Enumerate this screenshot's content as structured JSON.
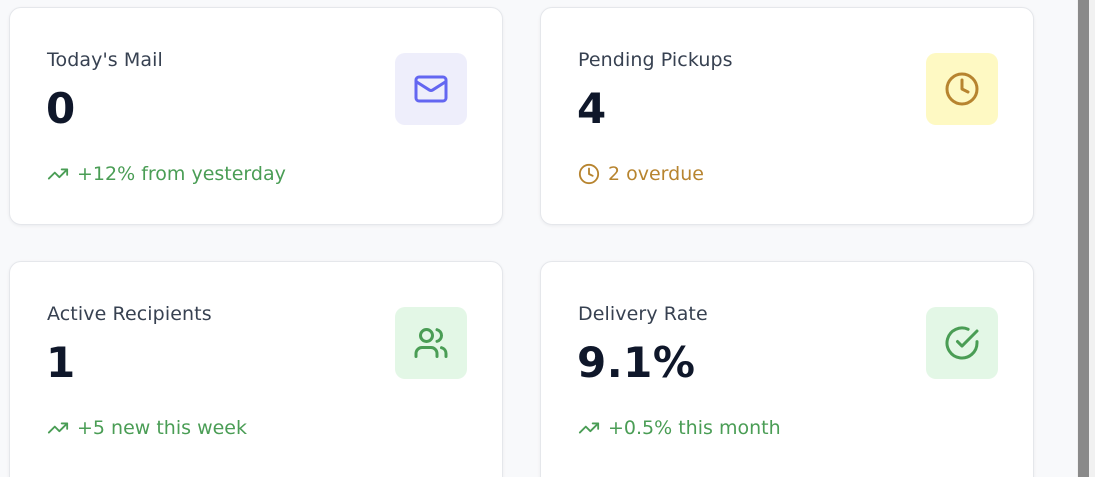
{
  "colors": {
    "page_background": "#f8f9fb",
    "positive_trend": "#4a9d55",
    "warning_trend": "#b7842f",
    "mail_icon_bg": "#eeeefb",
    "mail_icon": "#6366f1",
    "pickups_icon_bg": "#fef9c3",
    "pickups_icon": "#b7842f",
    "recipients_icon_bg": "#e3f7e6",
    "recipients_icon": "#4a9d55",
    "delivery_icon_bg": "#e3f7e6",
    "delivery_icon": "#4a9d55"
  },
  "stats": {
    "todays_mail": {
      "label": "Today's Mail",
      "value": "0",
      "trend_text": "+12% from yesterday",
      "trend_icon": "trending-up-icon",
      "icon": "mail-icon"
    },
    "pending_pickups": {
      "label": "Pending Pickups",
      "value": "4",
      "trend_text": "2 overdue",
      "trend_icon": "clock-icon",
      "icon": "clock-icon"
    },
    "active_recipients": {
      "label": "Active Recipients",
      "value": "1",
      "trend_text": "+5 new this week",
      "trend_icon": "trending-up-icon",
      "icon": "users-icon"
    },
    "delivery_rate": {
      "label": "Delivery Rate",
      "value": "9.1%",
      "trend_text": "+0.5% this month",
      "trend_icon": "trending-up-icon",
      "icon": "check-circle-icon"
    }
  }
}
